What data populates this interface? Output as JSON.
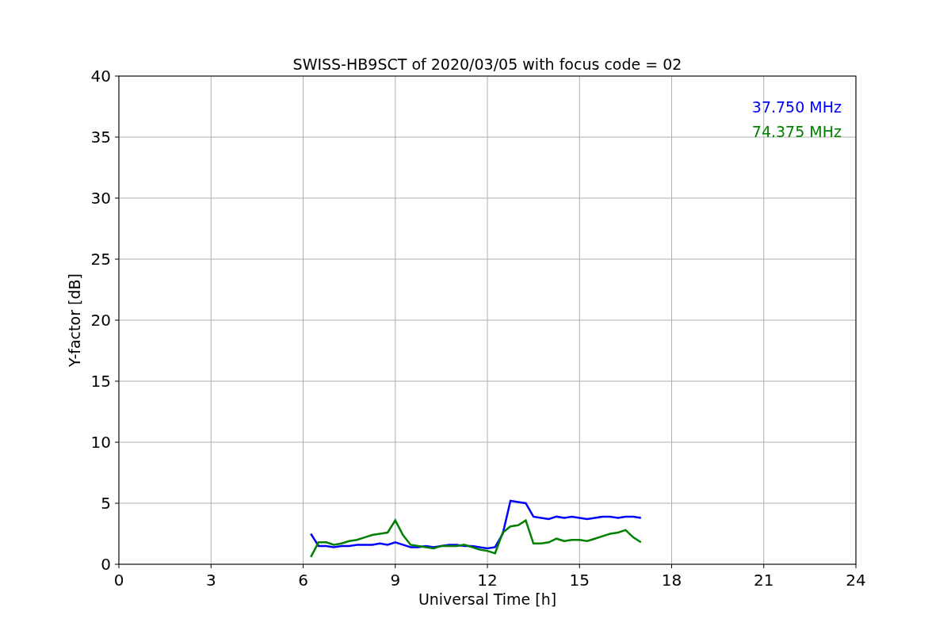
{
  "chart": {
    "chart_data": {
      "type": "line",
      "title": "SWISS-HB9SCT of 2020/03/05 with focus code = 02",
      "xlabel": "Universal Time [h]",
      "ylabel": "Y-factor [dB]",
      "x": [
        6.25,
        6.5,
        6.75,
        7,
        7.25,
        7.5,
        7.75,
        8,
        8.25,
        8.5,
        8.75,
        9,
        9.25,
        9.5,
        9.75,
        10,
        10.25,
        10.5,
        10.75,
        11,
        11.25,
        11.5,
        11.75,
        12,
        12.25,
        12.5,
        12.75,
        13,
        13.25,
        13.5,
        13.75,
        14,
        14.25,
        14.5,
        14.75,
        15,
        15.25,
        15.5,
        15.75,
        16,
        16.25,
        16.5,
        16.75,
        17
      ],
      "series": [
        {
          "name": "37.750 MHz",
          "color": "#0000ff",
          "values": [
            2.5,
            1.5,
            1.5,
            1.4,
            1.5,
            1.5,
            1.6,
            1.6,
            1.6,
            1.7,
            1.6,
            1.8,
            1.6,
            1.4,
            1.4,
            1.5,
            1.4,
            1.5,
            1.6,
            1.6,
            1.5,
            1.5,
            1.4,
            1.3,
            1.4,
            2.5,
            5.2,
            5.1,
            5.0,
            3.9,
            3.8,
            3.7,
            3.9,
            3.8,
            3.9,
            3.8,
            3.7,
            3.8,
            3.9,
            3.9,
            3.8,
            3.9,
            3.9,
            3.8
          ]
        },
        {
          "name": "74.375 MHz",
          "color": "#008000",
          "values": [
            0.6,
            1.8,
            1.8,
            1.6,
            1.7,
            1.9,
            2.0,
            2.2,
            2.4,
            2.5,
            2.6,
            3.6,
            2.4,
            1.6,
            1.5,
            1.4,
            1.3,
            1.5,
            1.5,
            1.5,
            1.6,
            1.4,
            1.2,
            1.1,
            0.9,
            2.6,
            3.1,
            3.2,
            3.6,
            1.7,
            1.7,
            1.8,
            2.1,
            1.9,
            2.0,
            2.0,
            1.9,
            2.1,
            2.3,
            2.5,
            2.6,
            2.8,
            2.2,
            1.8
          ]
        }
      ],
      "grid": true,
      "xlim": [
        0,
        24
      ],
      "ylim": [
        0,
        40
      ],
      "xticks": [
        0,
        3,
        6,
        9,
        12,
        15,
        18,
        21,
        24
      ],
      "yticks": [
        0,
        5,
        10,
        15,
        20,
        25,
        30,
        35,
        40
      ]
    }
  }
}
